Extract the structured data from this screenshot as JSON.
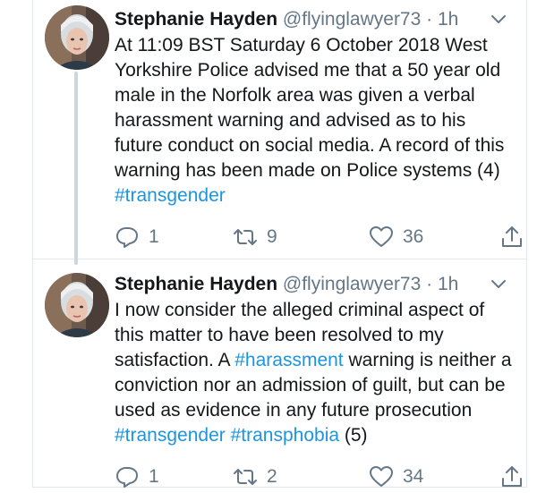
{
  "tweets": [
    {
      "name": "Stephanie Hayden",
      "handle": "@flyinglawyer73",
      "dot": "·",
      "time": "1h",
      "text_parts": [
        "At 11:09 BST Saturday 6 October 2018 West Yorkshire Police advised me that a 50 year old male in the Norfolk area was given a verbal harassment warning and advised as to his future conduct on social media. A record of this warning has been made on Police systems (4) "
      ],
      "hashtags": [
        "#transgender"
      ],
      "replies": "1",
      "retweets": "9",
      "likes": "36"
    },
    {
      "name": "Stephanie Hayden",
      "handle": "@flyinglawyer73",
      "dot": "·",
      "time": "1h",
      "text_a": "I now consider the alleged criminal aspect of this matter to have been resolved to my satisfaction. A ",
      "hashtag_a": "#harassment",
      "text_b": " warning is neither a conviction nor an admission of guilt,  but can be used as evidence in any future prosecution ",
      "hashtag_b": "#transgender",
      "text_c": " ",
      "hashtag_c": "#transphobia",
      "text_d": " (5)",
      "replies": "1",
      "retweets": "2",
      "likes": "34"
    }
  ],
  "colors": {
    "link": "#1b95e0",
    "muted": "#657786"
  },
  "icons": [
    "reply-icon",
    "retweet-icon",
    "like-icon",
    "share-icon",
    "chevron-down-icon"
  ]
}
